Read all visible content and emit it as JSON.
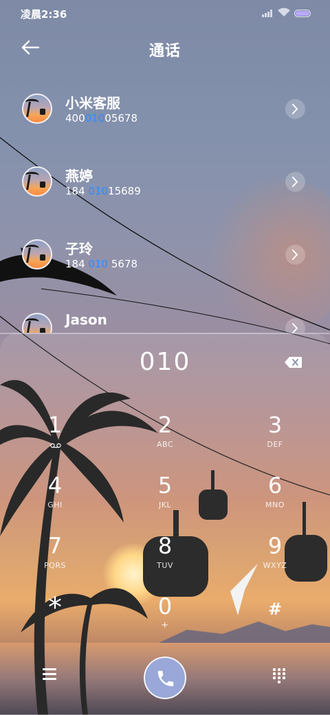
{
  "status_bar": {
    "time": "凌晨2:36",
    "icons": [
      "signal-icon",
      "wifi-icon",
      "battery-icon"
    ]
  },
  "header": {
    "title": "通话",
    "back_icon": "back-arrow-icon"
  },
  "contacts": [
    {
      "name": "小米客服",
      "number_before": "400",
      "number_match": "010",
      "number_after": "05678"
    },
    {
      "name": "燕婷",
      "number_before": "184 ",
      "number_match": "010",
      "number_after": "15689"
    },
    {
      "name": "子玲",
      "number_before": "184 ",
      "number_match": "010",
      "number_after": " 5678"
    },
    {
      "name": "Jason",
      "number_before": "",
      "number_match": "",
      "number_after": ""
    }
  ],
  "dialer": {
    "dialed_number": "010",
    "keys": [
      {
        "digit": "1",
        "sub": ""
      },
      {
        "digit": "2",
        "sub": "ABC"
      },
      {
        "digit": "3",
        "sub": "DEF"
      },
      {
        "digit": "4",
        "sub": "GHI"
      },
      {
        "digit": "5",
        "sub": "JKL"
      },
      {
        "digit": "6",
        "sub": "MNO"
      },
      {
        "digit": "7",
        "sub": "PQRS"
      },
      {
        "digit": "8",
        "sub": "TUV"
      },
      {
        "digit": "9",
        "sub": "WXYZ"
      },
      {
        "digit": "*",
        "sub": ""
      },
      {
        "digit": "0",
        "sub": "+"
      },
      {
        "digit": "#",
        "sub": ""
      }
    ],
    "icons": [
      "backspace-icon",
      "voicemail-icon",
      "menu-icon",
      "call-icon",
      "dialpad-icon"
    ]
  },
  "colors": {
    "match_highlight": "#2f8cff",
    "call_button": "#99a8d8"
  }
}
